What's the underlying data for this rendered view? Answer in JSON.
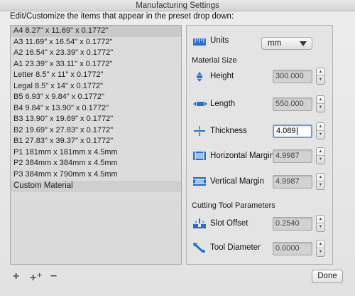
{
  "window": {
    "title": "Manufacturing Settings"
  },
  "prompt": "Edit/Customize the items that appear in the preset drop down:",
  "presets": [
    "A4 8.27\" x 11.69\" x 0.1772\"",
    "A3 11.69\" x 16.54\" x 0.1772\"",
    "A2 16.54\" x 23.39\" x 0.1772\"",
    "A1 23.39\" x 33.11\" x 0.1772\"",
    "Letter 8.5\" x 11\" x 0.1772\"",
    "Legal 8.5\" x 14\" x 0.1772\"",
    "B5 6.93\" x 9.84\" x 0.1772\"",
    "B4 9.84\" x 13.90\" x 0.1772\"",
    "B3 13.90\" x 19.69\" x 0.1772\"",
    "B2 19.69\" x 27.83\" x 0.1772\"",
    "B1 27.83\" x 39.37\" x 0.1772\"",
    "P1 181mm x 181mm x 4.5mm",
    "P2 384mm x 384mm x 4.5mm",
    "P3 384mm x 790mm x 4.5mm"
  ],
  "custom_material": "Custom Material",
  "units": {
    "label": "Units",
    "value": "mm"
  },
  "material_size": {
    "title": "Material Size",
    "height": {
      "label": "Height",
      "value": "300.000"
    },
    "length": {
      "label": "Length",
      "value": "550.000"
    },
    "thickness": {
      "label": "Thickness",
      "value": "4.089"
    },
    "horizontal_margin": {
      "label": "Horizontal Margin",
      "value": "4.9987"
    },
    "vertical_margin": {
      "label": "Vertical Margin",
      "value": "4.9987"
    }
  },
  "cutting_tool": {
    "title": "Cutting Tool Parameters",
    "slot_offset": {
      "label": "Slot  Offset",
      "value": "0.2540"
    },
    "tool_diameter": {
      "label": "Tool Diameter",
      "value": "0.0000"
    }
  },
  "toolbar": {
    "add": "+",
    "add_plus": "+⁺",
    "remove": "−",
    "done": "Done"
  },
  "colors": {
    "accent": "#6ca0dc",
    "icon_blue": "#2a6fc9"
  }
}
